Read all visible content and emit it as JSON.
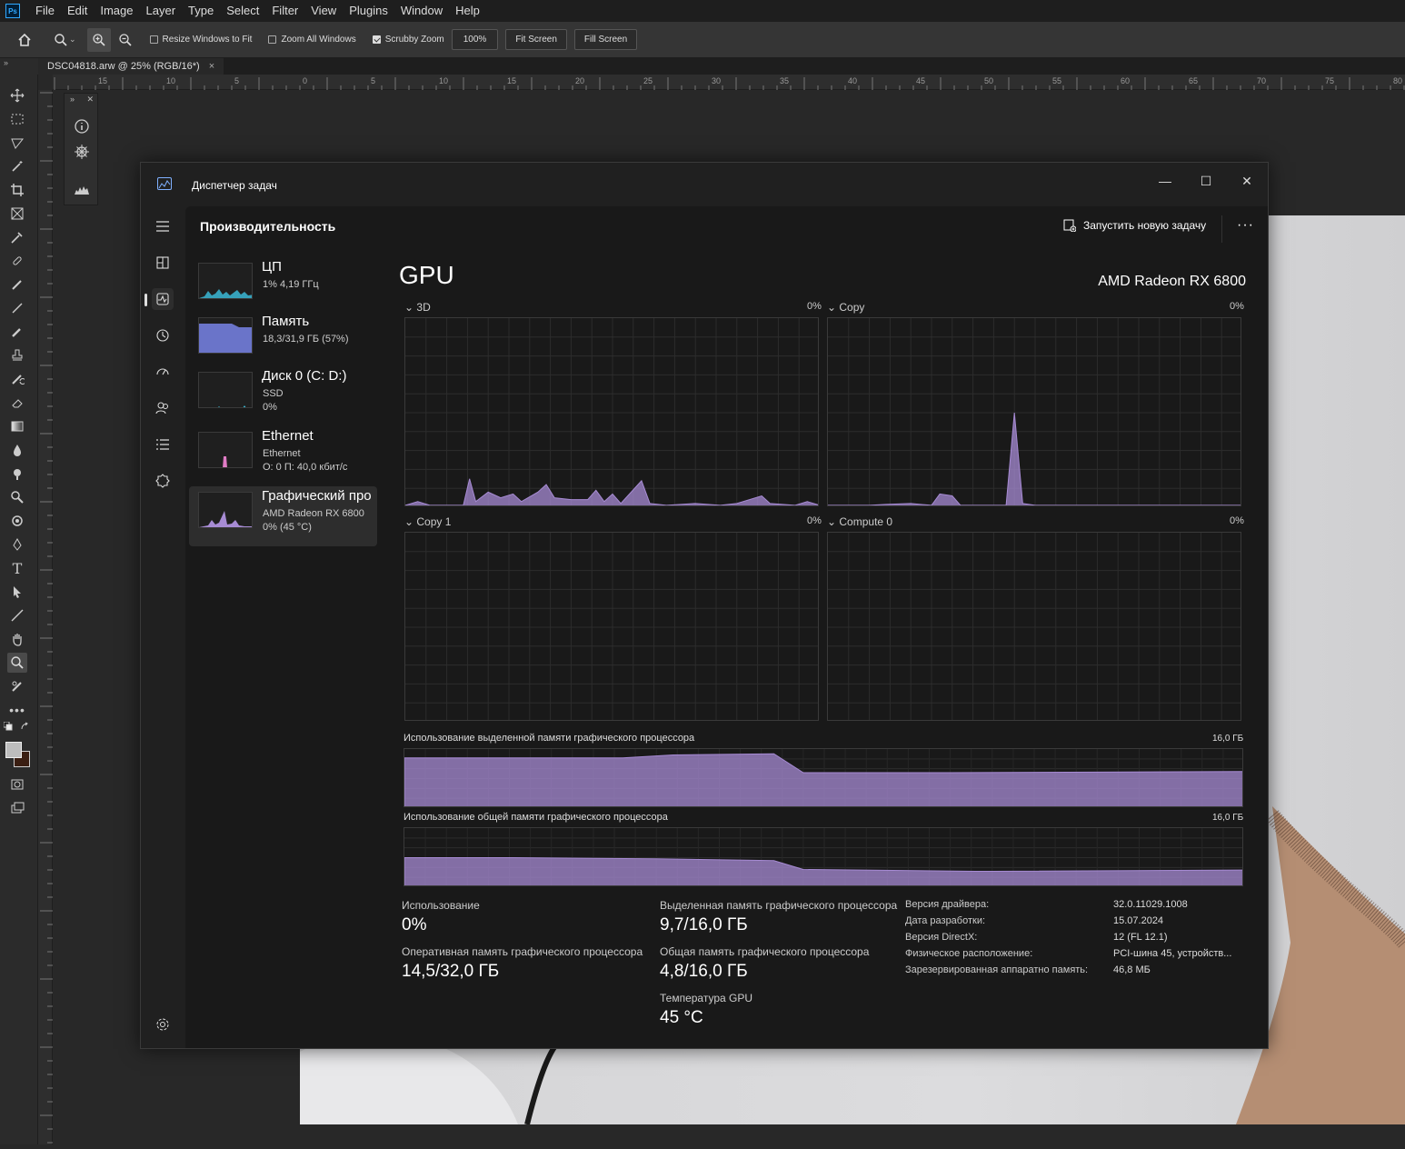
{
  "menubar": {
    "logo": "Ps",
    "items": [
      "File",
      "Edit",
      "Image",
      "Layer",
      "Type",
      "Select",
      "Filter",
      "View",
      "Plugins",
      "Window",
      "Help"
    ]
  },
  "options": {
    "resize_windows": "Resize Windows to Fit",
    "zoom_all": "Zoom All Windows",
    "scrubby_zoom": "Scrubby Zoom",
    "zoom_value": "100%",
    "fit_screen": "Fit Screen",
    "fill_screen": "Fill Screen"
  },
  "document_tab": {
    "title": "DSC04818.arw @ 25% (RGB/16*)",
    "close": "×"
  },
  "tool_header": "»",
  "ruler_top_labels": [
    "15",
    "10",
    "5",
    "0",
    "5",
    "10",
    "15",
    "20",
    "25",
    "30",
    "35",
    "40",
    "45",
    "50",
    "55",
    "60",
    "65",
    "70",
    "75",
    "80"
  ],
  "task_manager": {
    "window_title": "Диспетчер задач",
    "controls": {
      "minimize": "—",
      "maximize": "☐",
      "close": "✕"
    },
    "page_title": "Производительность",
    "run_task": "Запустить новую задачу",
    "more": "···",
    "perf_items": [
      {
        "name": "ЦП",
        "sub1": "1% 4,19 ГГц",
        "sub2": ""
      },
      {
        "name": "Память",
        "sub1": "18,3/31,9 ГБ (57%)",
        "sub2": ""
      },
      {
        "name": "Диск 0 (C: D:)",
        "sub1": "SSD",
        "sub2": "0%"
      },
      {
        "name": "Ethernet",
        "sub1": "Ethernet",
        "sub2": "О: 0 П: 40,0 кбит/с"
      },
      {
        "name": "Графический про",
        "sub1": "AMD Radeon RX 6800",
        "sub2": "0% (45 °C)"
      }
    ],
    "gpu_title": "GPU",
    "gpu_model": "AMD Radeon RX 6800",
    "engines": [
      {
        "name": "3D",
        "pct": "0%"
      },
      {
        "name": "Copy",
        "pct": "0%"
      },
      {
        "name": "Copy 1",
        "pct": "0%"
      },
      {
        "name": "Compute 0",
        "pct": "0%"
      }
    ],
    "dedicated_mem_label": "Использование выделенной памяти графического процессора",
    "dedicated_mem_max": "16,0 ГБ",
    "shared_mem_label": "Использование общей памяти графического процессора",
    "shared_mem_max": "16,0 ГБ",
    "stats": {
      "usage_label": "Использование",
      "usage_value": "0%",
      "gpu_ram_label": "Оперативная память графического процессора",
      "gpu_ram_value": "14,5/32,0 ГБ",
      "dedicated_label": "Выделенная память графического процессора",
      "dedicated_value": "9,7/16,0 ГБ",
      "shared_label": "Общая память графического процессора",
      "shared_value": "4,8/16,0 ГБ",
      "temp_label": "Температура GPU",
      "temp_value": "45 °C"
    },
    "info": [
      {
        "k": "Версия драйвера:",
        "v": "32.0.11029.1008"
      },
      {
        "k": "Дата разработки:",
        "v": "15.07.2024"
      },
      {
        "k": "Версия DirectX:",
        "v": "12 (FL 12.1)"
      },
      {
        "k": "Физическое расположение:",
        "v": "PCI-шина 45, устройств..."
      },
      {
        "k": "Зарезервированная аппаратно память:",
        "v": "46,8 МБ"
      }
    ]
  },
  "colors": {
    "accent_gpu": "#a78bd4",
    "memory_fill": "#6a74c9",
    "cpu_line": "#3bb9d6",
    "ethernet": "#e07cc5"
  }
}
